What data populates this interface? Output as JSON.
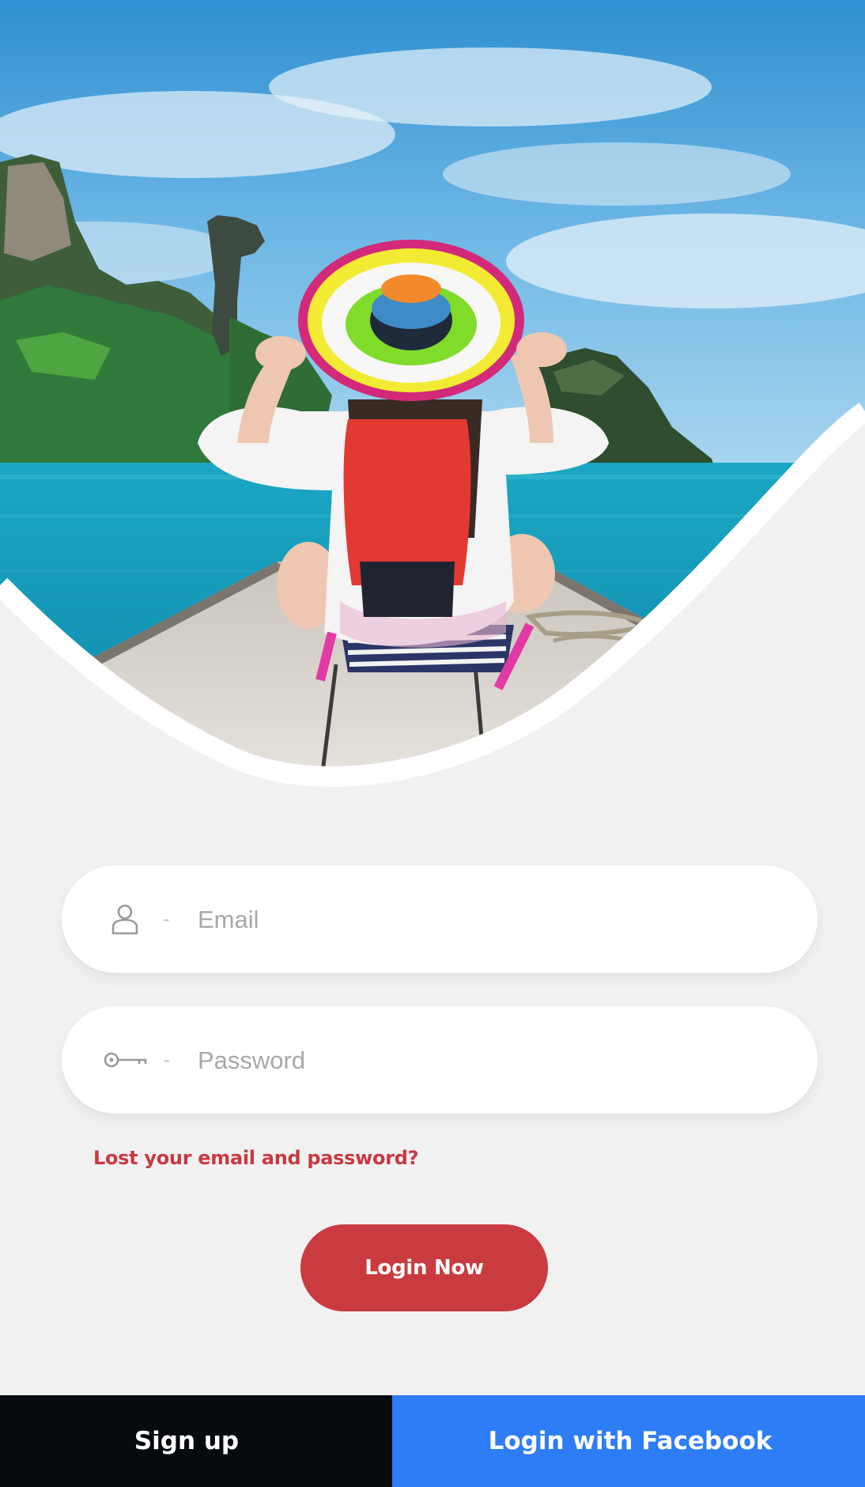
{
  "form": {
    "email": {
      "placeholder": "Email",
      "value": "",
      "icon": "user-icon"
    },
    "password": {
      "placeholder": "Password",
      "value": "",
      "icon": "key-icon"
    },
    "separator": "-",
    "lost_link": "Lost your email and password?",
    "login_label": "Login Now"
  },
  "bottom_bar": {
    "signup_label": "Sign up",
    "facebook_label": "Login with Facebook"
  },
  "colors": {
    "accent_red": "#c93b3e",
    "facebook_blue": "#2f7df6",
    "signup_black": "#070a0f",
    "background": "#f1f1f2"
  }
}
